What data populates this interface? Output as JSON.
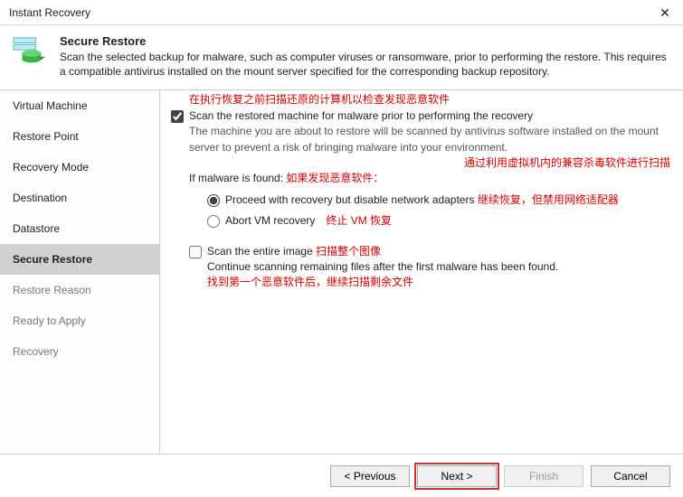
{
  "window": {
    "title": "Instant Recovery"
  },
  "header": {
    "heading": "Secure Restore",
    "desc": "Scan the selected backup for malware, such as computer viruses or ransomware, prior to performing the restore. This requires a compatible antivirus installed on the mount server specified for the corresponding backup repository."
  },
  "sidebar": {
    "items": [
      {
        "label": "Virtual Machine"
      },
      {
        "label": "Restore Point"
      },
      {
        "label": "Recovery Mode"
      },
      {
        "label": "Destination"
      },
      {
        "label": "Datastore"
      },
      {
        "label": "Secure Restore"
      },
      {
        "label": "Restore Reason"
      },
      {
        "label": "Ready to Apply"
      },
      {
        "label": "Recovery"
      }
    ],
    "selected_index": 5
  },
  "main": {
    "ann_top": "在执行恢复之前扫描还原的计算机以检查发现恶意软件",
    "scan_checkbox_label": "Scan the restored machine for malware prior to performing the recovery",
    "scan_checkbox_checked": true,
    "scan_desc": "The machine you are about to restore will be scanned by antivirus software installed on the mount server to prevent a risk of bringing malware into your environment.",
    "ann_mount": "通过利用虚拟机内的兼容杀毒软件进行扫描",
    "if_found_label": "If malware is found:",
    "ann_if_found": "如果发现恶意软件：",
    "radio_proceed": "Proceed with recovery but disable network adapters",
    "ann_proceed": "继续恢复，但禁用网络适配器",
    "radio_abort": "Abort VM recovery",
    "ann_abort": "终止 VM 恢复",
    "radio_selected": "proceed",
    "entire_checkbox_label": "Scan the entire image",
    "ann_entire": "扫描整个图像",
    "entire_checkbox_checked": false,
    "entire_desc": "Continue scanning remaining files after the first malware has been found.",
    "ann_entire_desc": "找到第一个恶意软件后，继续扫描剩余文件"
  },
  "footer": {
    "previous": "< Previous",
    "next": "Next >",
    "finish": "Finish",
    "cancel": "Cancel"
  }
}
